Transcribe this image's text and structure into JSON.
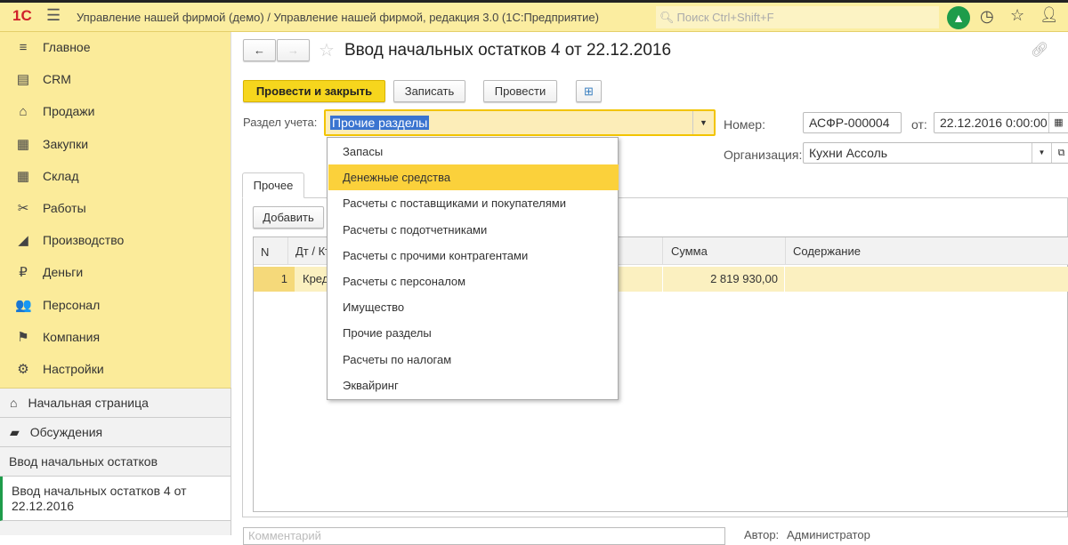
{
  "topbar": {
    "logo": "1С",
    "title": "Управление нашей фирмой (демо) / Управление нашей фирмой, редакция 3.0  (1С:Предприятие)",
    "search_placeholder": "Поиск Ctrl+Shift+F"
  },
  "sidebar": {
    "items": [
      {
        "label": "Главное",
        "icon": "≡"
      },
      {
        "label": "CRM",
        "icon": "▤"
      },
      {
        "label": "Продажи",
        "icon": "⌂"
      },
      {
        "label": "Закупки",
        "icon": "▦"
      },
      {
        "label": "Склад",
        "icon": "▦"
      },
      {
        "label": "Работы",
        "icon": "✂"
      },
      {
        "label": "Производство",
        "icon": "◢"
      },
      {
        "label": "Деньги",
        "icon": "₽"
      },
      {
        "label": "Персонал",
        "icon": "👥"
      },
      {
        "label": "Компания",
        "icon": "⚑"
      },
      {
        "label": "Настройки",
        "icon": "⚙"
      }
    ]
  },
  "bottom": {
    "home": "Начальная страница",
    "discussions": "Обсуждения",
    "list": "Ввод начальных остатков",
    "current": "Ввод начальных остатков 4 от 22.12.2016"
  },
  "doc": {
    "title": "Ввод начальных остатков 4 от 22.12.2016",
    "buttons": {
      "post_close": "Провести и закрыть",
      "save": "Записать",
      "post": "Провести"
    },
    "section_label": "Раздел учета:",
    "section_value": "Прочие разделы",
    "number_label": "Номер:",
    "number_value": "АСФР-000004",
    "date_label": "от:",
    "date_value": "22.12.2016  0:00:00",
    "org_label": "Организация:",
    "org_value": "Кухни Ассоль",
    "tab": "Прочее",
    "add": "Добавить",
    "table": {
      "headers": [
        "N",
        "Дт / Кт",
        "Сумма",
        "Содержание"
      ],
      "rows": [
        {
          "n": "1",
          "type": "Кредит",
          "sum": "2 819 930,00",
          "content": ""
        }
      ]
    },
    "comment_placeholder": "Комментарий",
    "author_label": "Автор:",
    "author_value": "Администратор"
  },
  "dropdown": {
    "items": [
      "Запасы",
      "Денежные средства",
      "Расчеты с поставщиками и покупателями",
      "Расчеты с подотчетниками",
      "Расчеты с прочими контрагентами",
      "Расчеты с персоналом",
      "Имущество",
      "Прочие разделы",
      "Расчеты по налогам",
      "Эквайринг"
    ],
    "highlighted": 1
  },
  "colors": {
    "accent": "#fbd13b",
    "panel": "#fbeb9a",
    "notify": "#1e9c4a"
  }
}
